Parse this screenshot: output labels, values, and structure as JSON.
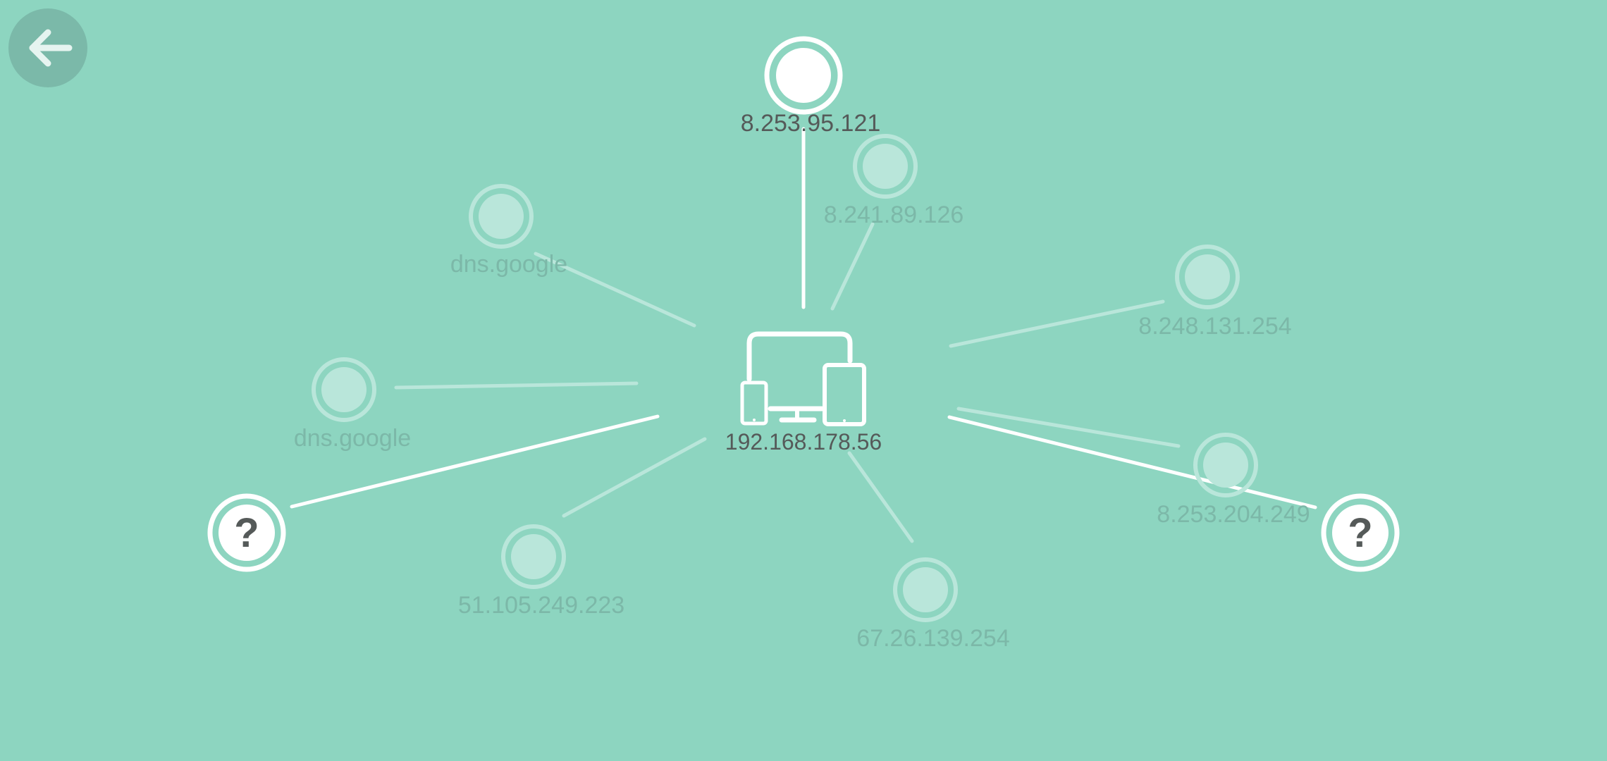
{
  "back_button": {
    "icon": "arrow-left-icon"
  },
  "device": {
    "ip": "192.168.178.56",
    "icon": "devices-icon"
  },
  "hosts": [
    {
      "id": "top",
      "label": "8.253.95.121",
      "state": "active",
      "icon": "circle-node-icon"
    },
    {
      "id": "h1",
      "label": "8.241.89.126",
      "state": "inactive"
    },
    {
      "id": "h2",
      "label": "dns.google",
      "state": "inactive"
    },
    {
      "id": "h3",
      "label": "8.248.131.254",
      "state": "inactive"
    },
    {
      "id": "h4",
      "label": "dns.google",
      "state": "inactive"
    },
    {
      "id": "h5",
      "label": "8.253.204.249",
      "state": "inactive"
    },
    {
      "id": "h6",
      "label": "51.105.249.223",
      "state": "inactive"
    },
    {
      "id": "h7",
      "label": "67.26.139.254",
      "state": "inactive"
    },
    {
      "id": "unknown-left",
      "label": "?",
      "state": "unknown"
    },
    {
      "id": "unknown-right",
      "label": "?",
      "state": "unknown"
    }
  ],
  "colors": {
    "background": "#8dd5c0",
    "active_line": "#ffffff",
    "faded": "#b9e6da",
    "label_dark": "#555a59",
    "label_faded": "#7cb8a8"
  }
}
